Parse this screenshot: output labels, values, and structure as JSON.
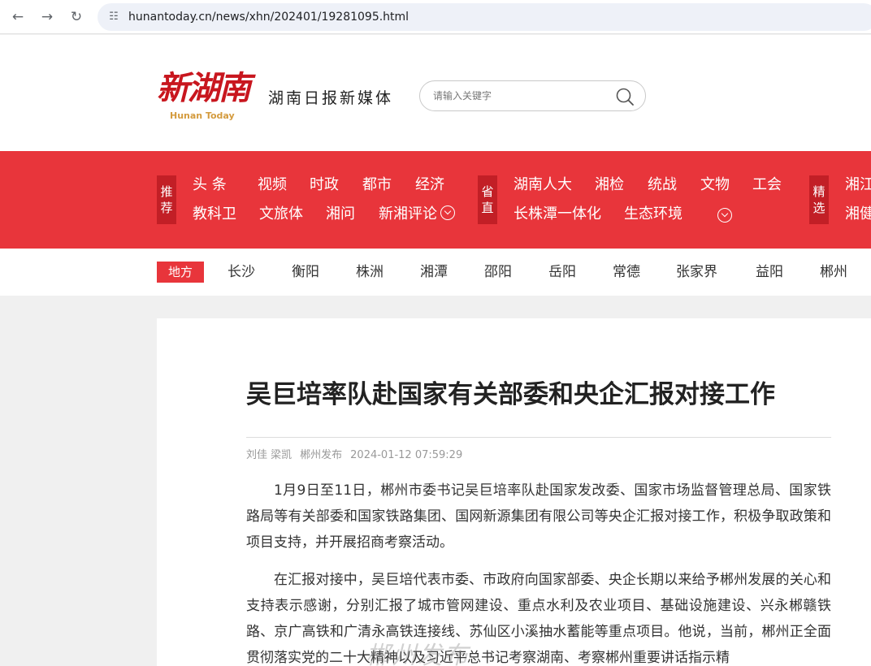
{
  "browser": {
    "url": "hunantoday.cn/news/xhn/202401/19281095.html"
  },
  "header": {
    "logo_cn": "新湖南",
    "logo_en": "Hunan Today",
    "tagline": "湖南日报新媒体",
    "search_placeholder": "请输入关键字"
  },
  "nav": {
    "tag_recommend": [
      "推",
      "荐"
    ],
    "row1": [
      "头  条",
      "视频",
      "时政",
      "都市",
      "经济"
    ],
    "row2": [
      "教科卫",
      "文旅体",
      "湘问",
      "新湘评论"
    ],
    "tag_province": [
      "省",
      "直"
    ],
    "province_row1": [
      "湖南人大",
      "湘检",
      "统战",
      "文物",
      "工会"
    ],
    "province_row2": [
      "长株潭一体化",
      "生态环境"
    ],
    "tag_select": [
      "精",
      "选"
    ],
    "select_row1": [
      "湘江"
    ],
    "select_row2": [
      "湘健"
    ]
  },
  "local": {
    "tag": "地方",
    "cities": [
      "长沙",
      "衡阳",
      "株洲",
      "湘潭",
      "邵阳",
      "岳阳",
      "常德",
      "张家界",
      "益阳",
      "郴州"
    ]
  },
  "article": {
    "title": "吴巨培率队赴国家有关部委和央企汇报对接工作",
    "authors": "刘佳 梁凯",
    "source": "郴州发布",
    "datetime": "2024-01-12 07:59:29",
    "paragraphs": [
      "1月9日至11日，郴州市委书记吴巨培率队赴国家发改委、国家市场监督管理总局、国家铁路局等有关部委和国家铁路集团、国网新源集团有限公司等央企汇报对接工作，积极争取政策和项目支持，并开展招商考察活动。",
      "在汇报对接中，吴巨培代表市委、市政府向国家部委、央企长期以来给予郴州发展的关心和支持表示感谢，分别汇报了城市管网建设、重点水利及农业项目、基础设施建设、兴永郴赣铁路、京广高铁和广清永高铁连接线、苏仙区小溪抽水蓄能等重点项目。他说，当前，郴州正全面贯彻落实党的二十大精神以及习近平总书记考察湖南、考察郴州重要讲话指示精"
    ]
  },
  "watermark": "郴州发布",
  "colors": {
    "brand_red": "#e8353b",
    "tag_red": "#c21f26",
    "logo_red": "#c8161e",
    "logo_gold": "#d49b3e"
  }
}
